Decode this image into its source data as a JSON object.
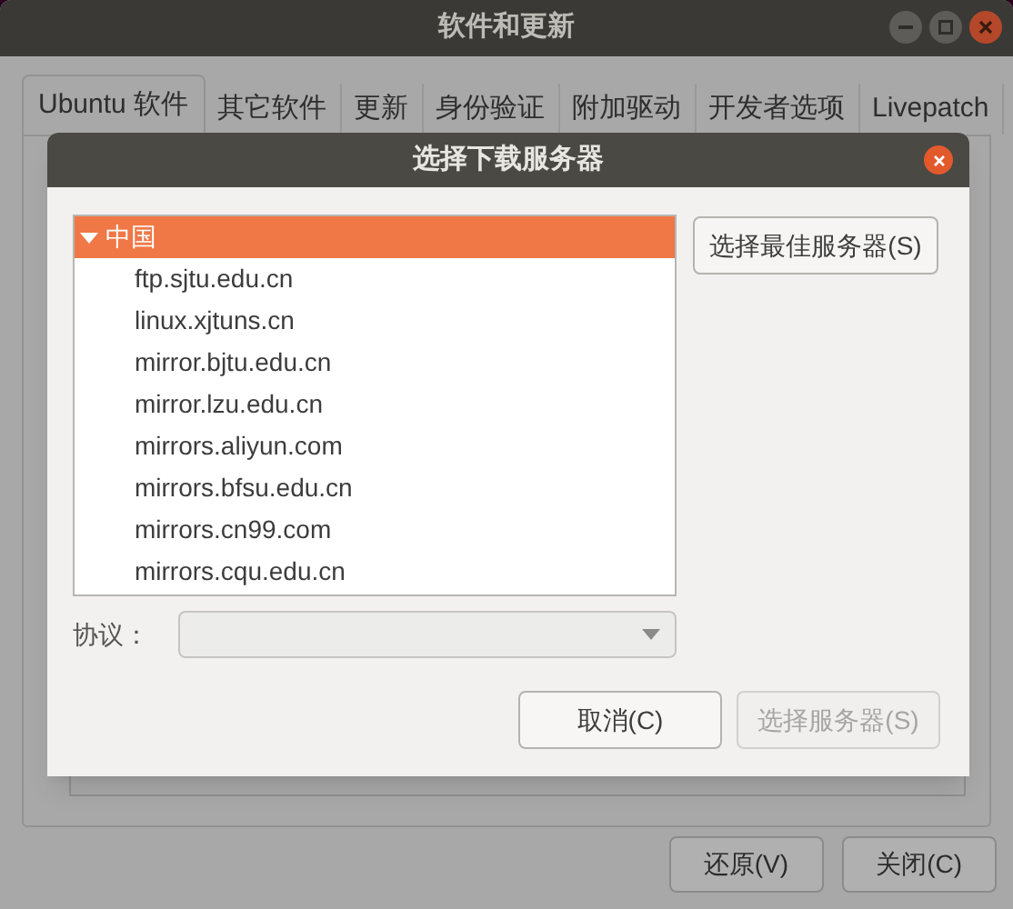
{
  "window": {
    "title": "软件和更新"
  },
  "tabs": [
    {
      "label": "Ubuntu 软件",
      "selected": true
    },
    {
      "label": "其它软件",
      "selected": false
    },
    {
      "label": "更新",
      "selected": false
    },
    {
      "label": "身份验证",
      "selected": false
    },
    {
      "label": "附加驱动",
      "selected": false
    },
    {
      "label": "开发者选项",
      "selected": false
    },
    {
      "label": "Livepatch",
      "selected": false
    }
  ],
  "footer_buttons": [
    {
      "label": "还原(V)"
    },
    {
      "label": "关闭(C)"
    }
  ],
  "dialog": {
    "title": "选择下载服务器",
    "servers": [
      {
        "label": "中国",
        "expanded": true,
        "selected": true,
        "children": [
          {
            "label": "ftp.sjtu.edu.cn",
            "selected": false
          },
          {
            "label": "linux.xjtuns.cn",
            "selected": false
          },
          {
            "label": "mirror.bjtu.edu.cn",
            "selected": false
          },
          {
            "label": "mirror.lzu.edu.cn",
            "selected": false
          },
          {
            "label": "mirrors.aliyun.com",
            "selected": false
          },
          {
            "label": "mirrors.bfsu.edu.cn",
            "selected": false
          },
          {
            "label": "mirrors.cn99.com",
            "selected": false
          },
          {
            "label": "mirrors.cqu.edu.cn",
            "selected": false
          }
        ]
      }
    ],
    "best_button": "选择最佳服务器(S)",
    "protocol": {
      "label": "协议："
    },
    "buttons": [
      {
        "label": "取消(C)",
        "disabled": false
      },
      {
        "label": "选择服务器(S)",
        "disabled": true
      }
    ]
  }
}
